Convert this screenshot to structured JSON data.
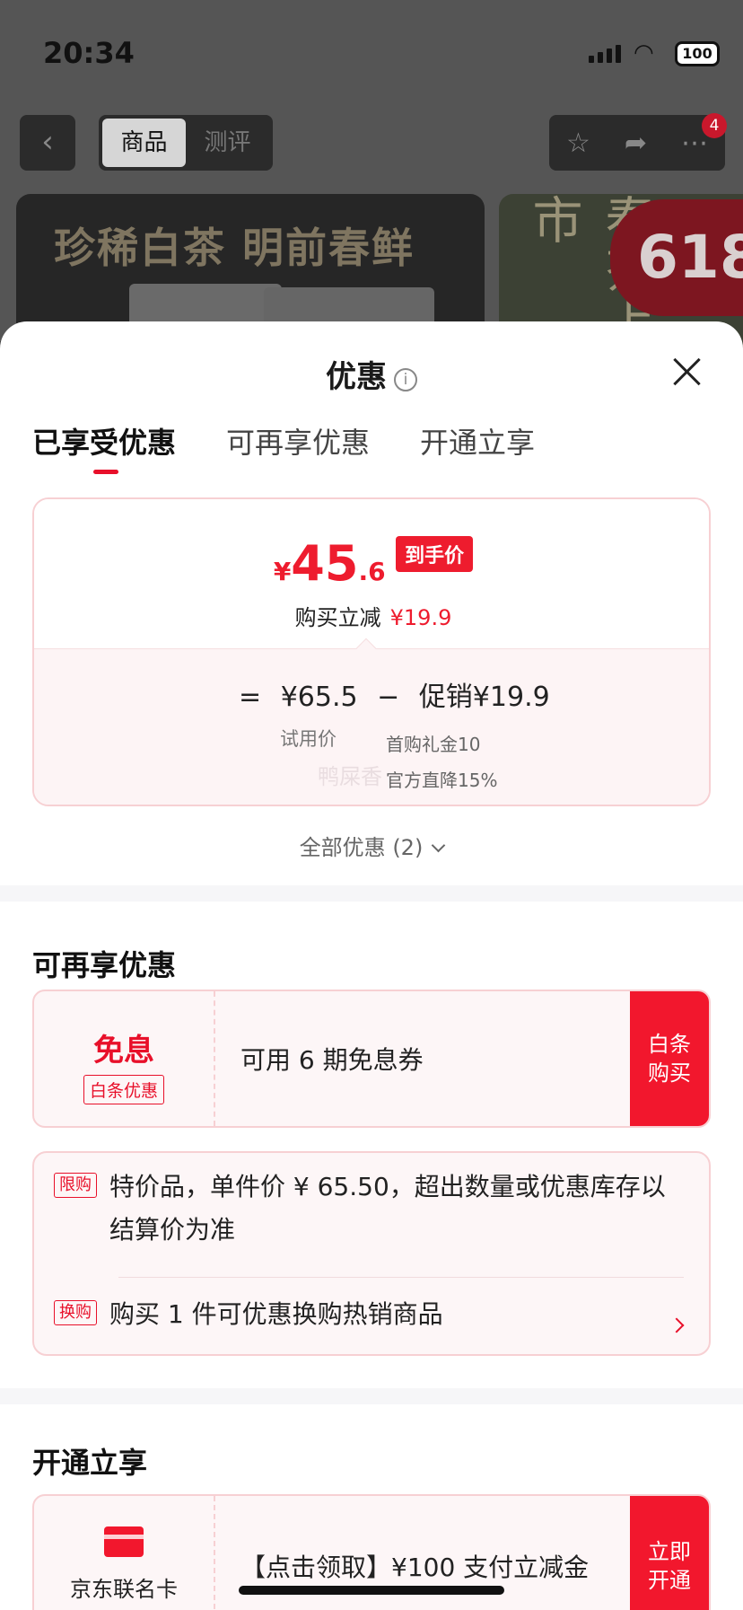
{
  "status_bar": {
    "time": "20:34",
    "battery": "100"
  },
  "nav": {
    "back_icon": "chevron-left-icon",
    "segments": [
      "商品",
      "测评"
    ],
    "active_segment": "商品",
    "actions": [
      "star-icon",
      "share-icon",
      "more-icon"
    ],
    "badge_count": "4"
  },
  "banners": {
    "main_text": "珍稀白茶 明前春鲜",
    "side_text": "春茶上市",
    "promo": "618"
  },
  "sheet": {
    "title": "优惠",
    "tabs": [
      "已享受优惠",
      "可再享优惠",
      "开通立享"
    ],
    "active_tab": 0,
    "price": {
      "currency": "¥",
      "integer": "45",
      "decimal": ".6",
      "final_tag": "到手价",
      "saving_label": "购买立减",
      "saving_amount": "¥19.9",
      "formula_eq": "=",
      "formula_base": "¥65.5",
      "formula_minus": "−",
      "formula_promo": "促销¥19.9",
      "base_label": "试用价",
      "promo_detail_1": "首购礼金10",
      "promo_detail_2": "官方直降15%",
      "watermark": "鸭屎香"
    },
    "all_promos": "全部优惠 (2)",
    "section_more": {
      "title": "可再享优惠",
      "coupon": {
        "left_title": "免息",
        "left_tag": "白条优惠",
        "text": "可用 6 期免息券",
        "button_line1": "白条",
        "button_line2": "购买"
      },
      "rules": [
        {
          "tag": "限购",
          "text": "特价品，单件价 ¥ 65.50，超出数量或优惠库存以结算价为准"
        },
        {
          "tag": "换购",
          "text": "购买 1 件可优惠换购热销商品"
        }
      ]
    },
    "section_open": {
      "title": "开通立享",
      "card": {
        "icon": "credit-card-icon",
        "name": "京东联名卡",
        "text": "【点击领取】¥100 支付立减金",
        "button_line1": "立即",
        "button_line2": "开通"
      }
    }
  },
  "colors": {
    "accent": "#ee1c2e",
    "coupon_bg": "#fdf6f7",
    "border": "#f7d0d3"
  }
}
